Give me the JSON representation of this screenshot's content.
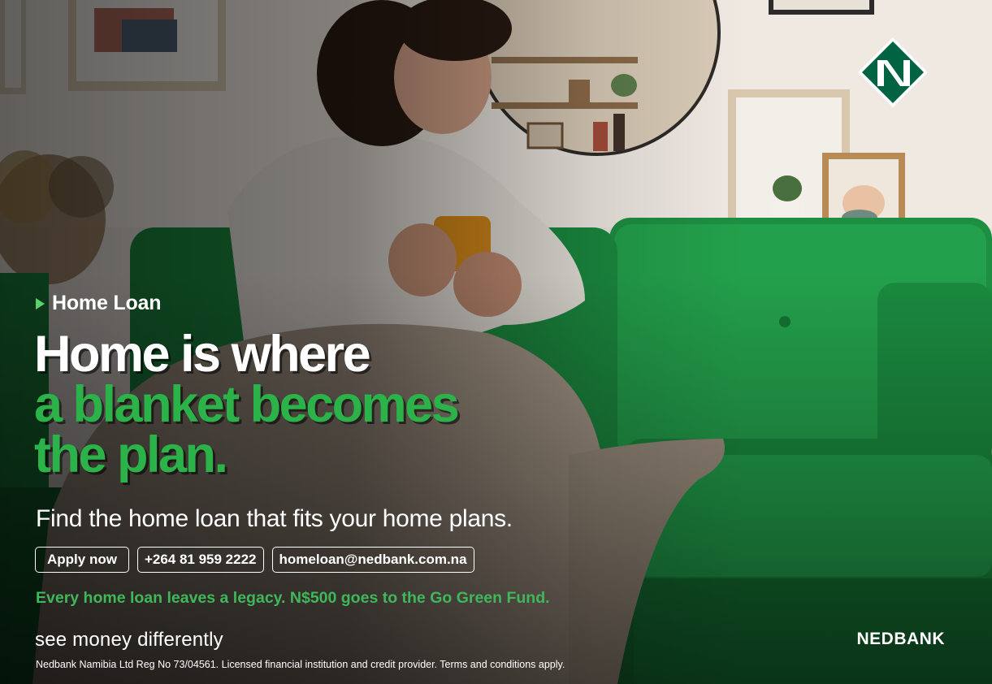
{
  "ad": {
    "eyebrow": "Home Loan",
    "headline": [
      "Home is where",
      "a blanket becomes",
      "the plan."
    ],
    "subline": "Find the home loan that fits your home plans.",
    "ctas": {
      "apply": "Apply now",
      "phone": "+264 81 959 2222",
      "email": "homeloan@nedbank.com.na"
    },
    "legacy": "Every home loan leaves a legacy. N$500 goes to the Go Green Fund.",
    "tagline": "see money differently",
    "brand": "NEDBANK",
    "legal": "Nedbank Namibia Ltd Reg No 73/04561. Licensed financial institution and credit provider. Terms and conditions apply."
  },
  "colors": {
    "brand_green": "#2bb34a",
    "logo_green": "#006341",
    "sofa_green": "#17823a",
    "text_white": "#ffffff"
  },
  "icons": {
    "eyebrow": "play-triangle-icon",
    "logo": "nedbank-n-logo-icon"
  }
}
